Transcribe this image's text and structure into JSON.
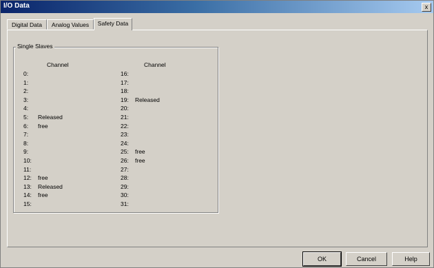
{
  "window": {
    "title": "I/O Data",
    "close_label": "x"
  },
  "tabs": [
    {
      "label": "Digital Data"
    },
    {
      "label": "Analog Values"
    },
    {
      "label": "Safety Data"
    }
  ],
  "group": {
    "legend": "Single Slaves",
    "col_head_left": "Channel",
    "col_head_right": "Channel",
    "left_rows": [
      {
        "num": "0:",
        "val": ""
      },
      {
        "num": "1:",
        "val": ""
      },
      {
        "num": "2:",
        "val": ""
      },
      {
        "num": "3:",
        "val": ""
      },
      {
        "num": "4:",
        "val": ""
      },
      {
        "num": "5:",
        "val": "Released"
      },
      {
        "num": "6:",
        "val": "free"
      },
      {
        "num": "7:",
        "val": ""
      },
      {
        "num": "8:",
        "val": ""
      },
      {
        "num": "9:",
        "val": ""
      },
      {
        "num": "10:",
        "val": ""
      },
      {
        "num": "11:",
        "val": ""
      },
      {
        "num": "12:",
        "val": "free"
      },
      {
        "num": "13:",
        "val": "Released"
      },
      {
        "num": "14:",
        "val": "free"
      },
      {
        "num": "15:",
        "val": ""
      }
    ],
    "right_rows": [
      {
        "num": "16:",
        "val": ""
      },
      {
        "num": "17:",
        "val": ""
      },
      {
        "num": "18:",
        "val": ""
      },
      {
        "num": "19:",
        "val": "Released"
      },
      {
        "num": "20:",
        "val": ""
      },
      {
        "num": "21:",
        "val": ""
      },
      {
        "num": "22:",
        "val": ""
      },
      {
        "num": "23:",
        "val": ""
      },
      {
        "num": "24:",
        "val": ""
      },
      {
        "num": "25:",
        "val": "free"
      },
      {
        "num": "26:",
        "val": "free"
      },
      {
        "num": "27:",
        "val": ""
      },
      {
        "num": "28:",
        "val": ""
      },
      {
        "num": "29:",
        "val": ""
      },
      {
        "num": "30:",
        "val": ""
      },
      {
        "num": "31:",
        "val": ""
      }
    ]
  },
  "buttons": {
    "ok": "OK",
    "cancel": "Cancel",
    "help": "Help"
  }
}
